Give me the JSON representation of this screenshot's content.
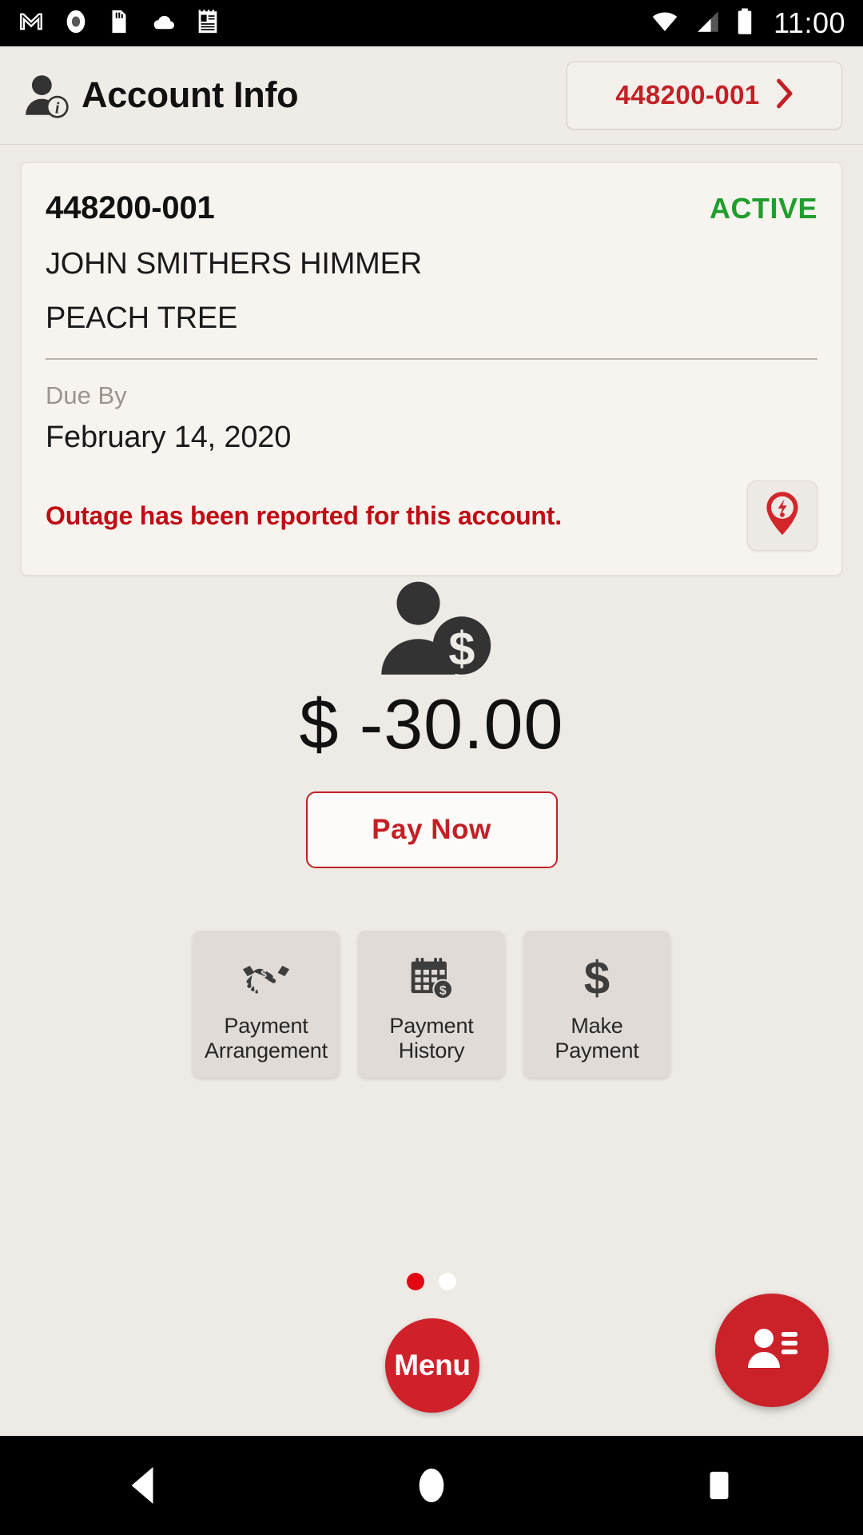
{
  "status_bar": {
    "icons": [
      "gmail-icon",
      "record-icon",
      "sd-card-icon",
      "cloud-icon",
      "notes-icon"
    ],
    "wifi": "wifi-icon",
    "signal": "cellular-signal-icon",
    "battery": "battery-icon",
    "time": "11:00"
  },
  "header": {
    "icon": "account-info-icon",
    "title": "Account Info",
    "account_chip": {
      "label": "448200-001",
      "chevron": "chevron-right-icon"
    }
  },
  "account_card": {
    "account_number": "448200-001",
    "status": "ACTIVE",
    "status_color": "#1F9E2C",
    "customer_name": "JOHN SMITHERS HIMMER",
    "service_address": "PEACH TREE",
    "due_by_label": "Due By",
    "due_date": "February 14, 2020",
    "outage_message": "Outage has been reported for this account.",
    "outage_color": "#C00C14",
    "outage_icon": "outage-pin-icon"
  },
  "balance": {
    "icon": "customer-balance-icon",
    "amount": "$ -30.00",
    "pay_now_label": "Pay Now",
    "accent_color": "#C32026"
  },
  "tiles": [
    {
      "icon": "handshake-dollar-icon",
      "line1": "Payment",
      "line2": "Arrangement"
    },
    {
      "icon": "calendar-dollar-icon",
      "line1": "Payment",
      "line2": "History"
    },
    {
      "icon": "dollar-sign-icon",
      "line1": "Make",
      "line2": "Payment"
    }
  ],
  "pager": {
    "total": 2,
    "active_index": 0,
    "active_color": "#E40613",
    "inactive_color": "#FFFFFF"
  },
  "bottom": {
    "menu_label": "Menu",
    "menu_color": "#D0202A",
    "fab_icon": "contact-card-icon",
    "fab_color": "#CB2128"
  },
  "nav_bar": {
    "back": "back-triangle-icon",
    "home": "home-circle-icon",
    "recents": "recents-square-icon"
  },
  "theme": {
    "page_background": "#EEEAE5",
    "card_background": "#F7F4F0",
    "tile_background": "#E1DBD7"
  }
}
